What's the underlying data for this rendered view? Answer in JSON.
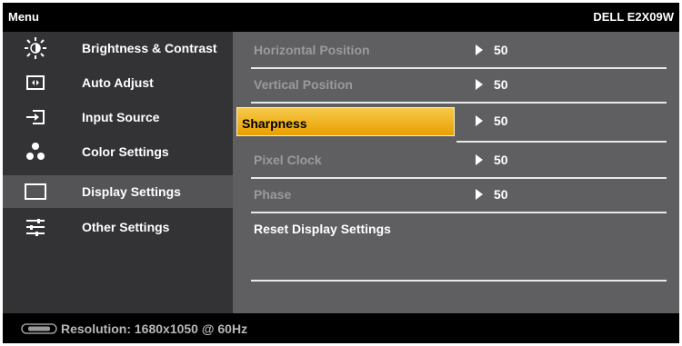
{
  "header": {
    "title": "Menu",
    "model": "DELL E2X09W"
  },
  "sidebar": {
    "items": [
      {
        "label": "Brightness & Contrast",
        "icon": "brightness-icon"
      },
      {
        "label": "Auto Adjust",
        "icon": "auto-adjust-icon"
      },
      {
        "label": "Input Source",
        "icon": "input-source-icon"
      },
      {
        "label": "Color Settings",
        "icon": "color-settings-icon"
      },
      {
        "label": "Display Settings",
        "icon": "display-settings-icon",
        "selected": true
      },
      {
        "label": "Other Settings",
        "icon": "other-settings-icon"
      }
    ]
  },
  "content": {
    "rows": [
      {
        "label": "Horizontal Position",
        "value": "50"
      },
      {
        "label": "Vertical Position",
        "value": "50"
      },
      {
        "label": "Sharpness",
        "value": "50",
        "highlighted": true
      },
      {
        "label": "Pixel Clock",
        "value": "50"
      },
      {
        "label": "Phase",
        "value": "50"
      }
    ],
    "reset_label": "Reset Display Settings"
  },
  "footer": {
    "resolution": "Resolution: 1680x1050 @ 60Hz",
    "icon": "vga-connector-icon"
  },
  "colors": {
    "highlight": "#f0b020",
    "sidebar_bg": "#333335",
    "content_bg": "#5f5f62",
    "selected_bg": "#545457"
  }
}
